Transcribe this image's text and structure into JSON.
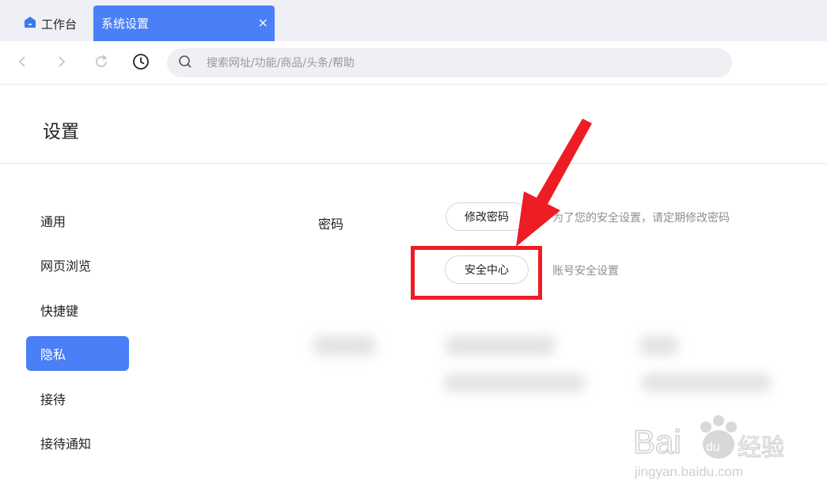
{
  "tabs": {
    "home_label": "工作台",
    "active_label": "系统设置",
    "close_symbol": "×"
  },
  "nav": {
    "back_icon": "chevron-left-icon",
    "forward_icon": "chevron-right-icon",
    "reload_icon": "reload-icon",
    "history_icon": "clock-icon"
  },
  "search": {
    "placeholder": "搜索网址/功能/商品/头条/帮助"
  },
  "header": {
    "title": "设置"
  },
  "sidebar": {
    "items": [
      {
        "label": "通用"
      },
      {
        "label": "网页浏览"
      },
      {
        "label": "快捷键"
      },
      {
        "label": "隐私",
        "active": true
      },
      {
        "label": "接待"
      },
      {
        "label": "接待通知"
      }
    ]
  },
  "password_section": {
    "label": "密码",
    "change_password_button": "修改密码",
    "change_password_hint": "为了您的安全设置，请定期修改密码",
    "security_center_button": "安全中心",
    "security_center_hint": "账号安全设置"
  },
  "colors": {
    "accent": "#4a7ff7",
    "annotation_red": "#ee1c25"
  },
  "watermark": {
    "brand": "Bai经验",
    "url": "jingyan.baidu.com"
  }
}
